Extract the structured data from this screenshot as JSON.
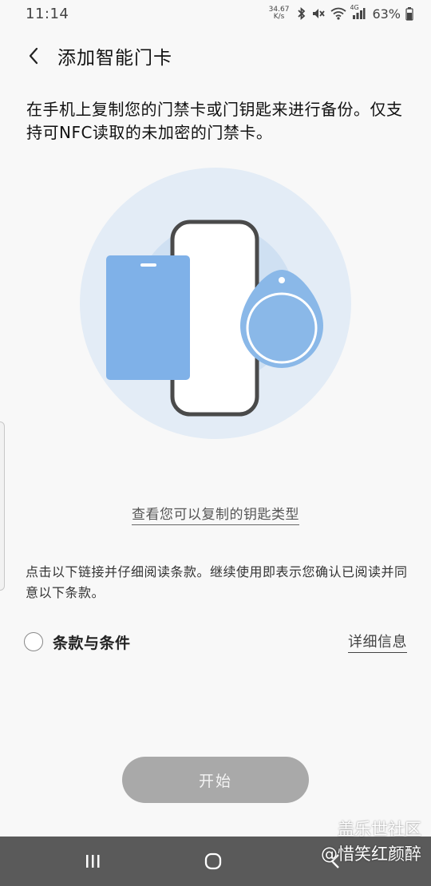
{
  "status_bar": {
    "time": "11:14",
    "net_speed_value": "34.67",
    "net_speed_unit": "K/s",
    "network_type": "4G",
    "battery": "63%"
  },
  "header": {
    "title": "添加智能门卡"
  },
  "intro": {
    "text": "在手机上复制您的门禁卡或门钥匙来进行备份。仅支持可NFC读取的未加密的门禁卡。"
  },
  "link": {
    "key_types": "查看您可以复制的钥匙类型"
  },
  "terms": {
    "note": "点击以下链接并仔细阅读条款。继续使用即表示您确认已阅读并同意以下条款。",
    "label": "条款与条件",
    "details": "详细信息",
    "checked": false
  },
  "start_button": {
    "label": "开始"
  },
  "watermark": {
    "line1": "盖乐世社区",
    "line2": "@惜笑红颜醉"
  },
  "colors": {
    "illustration_bg_outer": "#e3ecf6",
    "illustration_bg_inner": "#cfe0f2",
    "card_blue": "#7fb1e8",
    "tag_blue": "#8ab8e8",
    "phone_frame": "#4a4a4a",
    "start_button_bg": "#a9a9a9",
    "nav_bar_bg": "#5a5a5a"
  },
  "icons": {
    "back": "chevron-left-icon",
    "bluetooth": "bluetooth-icon",
    "mute": "mute-icon",
    "wifi": "wifi-icon",
    "signal": "signal-icon",
    "battery": "battery-icon",
    "recents": "recents-icon",
    "home": "home-icon",
    "back_nav": "back-nav-icon"
  }
}
